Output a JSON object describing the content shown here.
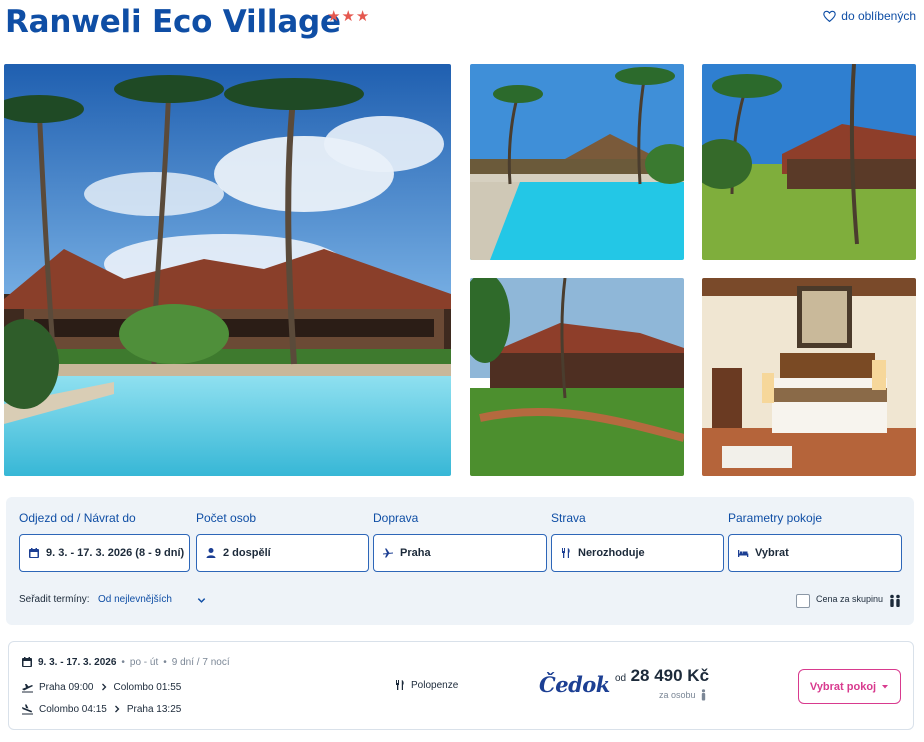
{
  "hotel": {
    "name": "Ranweli Eco Village",
    "stars": "★★★",
    "favorite_label": "do oblíbených"
  },
  "gallery": {
    "photos": [
      "resort-pool-main",
      "pool",
      "gardens-buildings",
      "lodges-lawn",
      "bedroom"
    ]
  },
  "search": {
    "dates_label": "Odjezd od / Návrat do",
    "dates_value": "9. 3. - 17. 3. 2026 (8 - 9 dní)",
    "persons_label": "Počet osob",
    "persons_value": "2 dospělí",
    "transport_label": "Doprava",
    "transport_value": "Praha",
    "board_label": "Strava",
    "board_value": "Nerozhoduje",
    "room_label": "Parametry pokoje",
    "room_value": "Vybrat",
    "sort_label": "Seřadit termíny:",
    "sort_value": "Od nejlevnějších",
    "group_price_label": "Cena za skupinu",
    "group_price_checked": false
  },
  "offer": {
    "dates": "9. 3. - 17. 3. 2026",
    "days": "po - út",
    "duration": "9 dní / 7 nocí",
    "outbound_from": "Praha 09:00",
    "outbound_to": "Colombo 01:55",
    "return_from": "Colombo 04:15",
    "return_to": "Praha 13:25",
    "board": "Polopenze",
    "operator": "Čedok",
    "price_prefix": "od",
    "price": "28 490 Kč",
    "price_note": "za osobu",
    "select_label": "Vybrat pokoj"
  },
  "colors": {
    "brand_blue": "#0f4ea5",
    "accent_pink": "#d83a8e",
    "star_red": "#e5584f",
    "panel_bg": "#eef3f8"
  }
}
